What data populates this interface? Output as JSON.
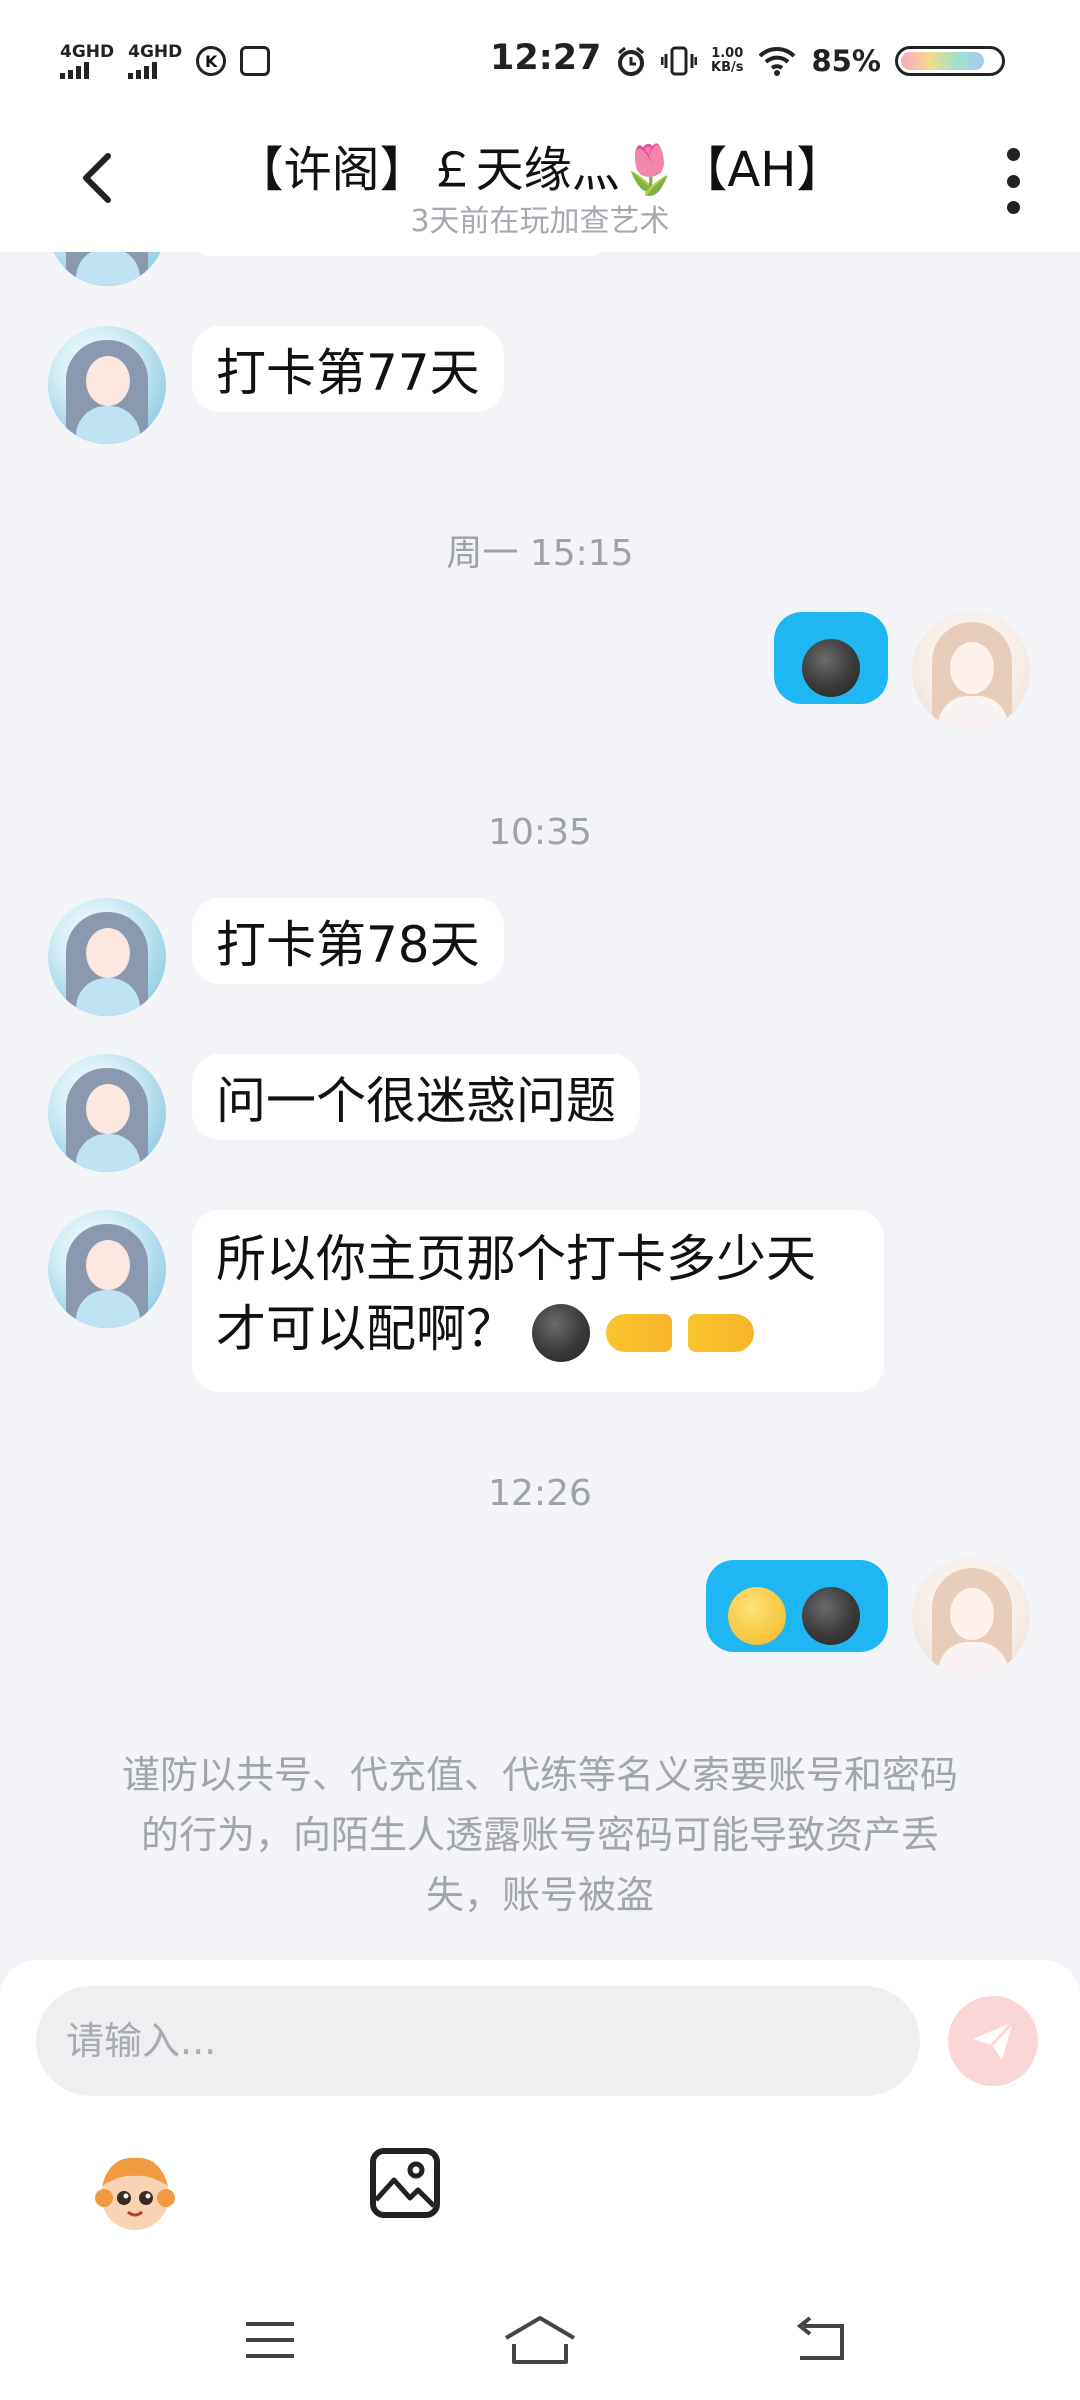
{
  "status_bar": {
    "network1": "4GHD",
    "network2": "4GHD",
    "time": "12:27",
    "net_speed_value": "1.00",
    "net_speed_unit": "KB/s",
    "battery": "85%",
    "battery_level": 0.85
  },
  "header": {
    "title": "【许阁】￡天缘灬🌷【AH】",
    "subtitle": "3天前在玩加查艺术"
  },
  "messages": [
    {
      "side": "left",
      "text": "打卡第77天"
    },
    {
      "timestamp": "周一 15:15"
    },
    {
      "side": "right",
      "emoji": [
        "wink-dark-emoji"
      ]
    },
    {
      "timestamp": "10:35"
    },
    {
      "side": "left",
      "text": "打卡第78天"
    },
    {
      "side": "left",
      "text": "问一个很迷惑问题"
    },
    {
      "side": "left",
      "text_line1": "所以你主页那个打卡多少天",
      "text_line2": "才可以配啊？"
    },
    {
      "timestamp": "12:26"
    },
    {
      "side": "right",
      "emoji": [
        "thinking-emoji",
        "wink-dark-emoji"
      ]
    }
  ],
  "safety_notice": {
    "line1": "谨防以共号、代充值、代练等名义索要账号和密码",
    "line2": "的行为，向陌生人透露账号密码可能导致资产丢",
    "line3": "失，账号被盗"
  },
  "input": {
    "placeholder": "请输入..."
  },
  "colors": {
    "accent_blue": "#1fb6f4",
    "send_button": "#fbd6d6",
    "background": "#f2f4f8"
  }
}
